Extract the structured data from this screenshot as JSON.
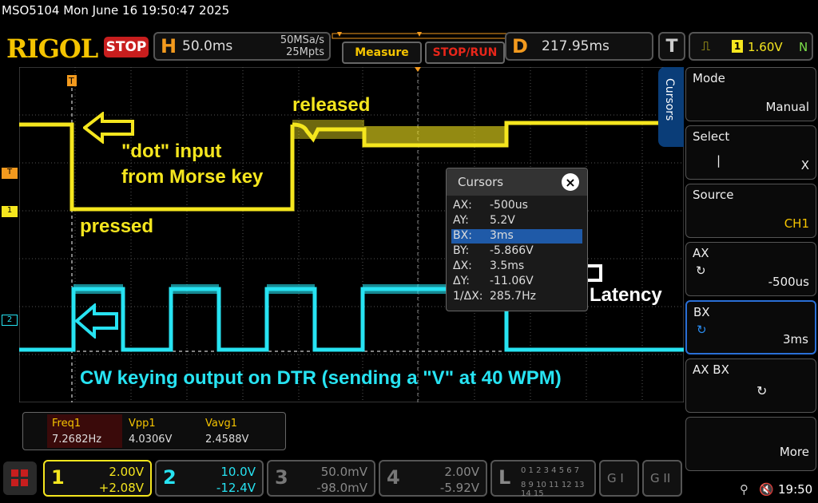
{
  "topline": "MSO5104  Mon June 16 19:50:47 2025",
  "brand": "RIGOL",
  "run_state": "STOP",
  "horizontal": {
    "letter": "H",
    "timebase": "50.0ms",
    "sample_rate": "50MSa/s",
    "depth": "25Mpts"
  },
  "buttons": {
    "measure": "Measure",
    "stop_run": "STOP/RUN"
  },
  "delay": {
    "letter": "D",
    "value": "217.95ms"
  },
  "trigger": {
    "letter": "T",
    "source": "1",
    "level": "1.60V",
    "mode": "N"
  },
  "side_tab": "Cursors",
  "menu": [
    {
      "title": "Mode",
      "value": "Manual"
    },
    {
      "title": "Select",
      "value": "X"
    },
    {
      "title": "Source",
      "value": "CH1"
    },
    {
      "title": "AX",
      "value": "-500us"
    },
    {
      "title": "BX",
      "value": "3ms"
    },
    {
      "title": "AX BX",
      "value": ""
    },
    {
      "title": "",
      "value": "More"
    }
  ],
  "cursors": {
    "title": "Cursors",
    "close": "×",
    "rows": [
      {
        "k": "AX:",
        "v": "-500us"
      },
      {
        "k": "AY:",
        "v": "5.2V"
      },
      {
        "k": "BX:",
        "v": "3ms"
      },
      {
        "k": "BY:",
        "v": "-5.866V"
      },
      {
        "k": "ΔX:",
        "v": "3.5ms"
      },
      {
        "k": "ΔY:",
        "v": "-11.06V"
      },
      {
        "k": "1/ΔX:",
        "v": "285.7Hz"
      }
    ]
  },
  "annotations": {
    "released": "released",
    "dot_line1": "\"dot\" input",
    "dot_line2": "from Morse key",
    "pressed": "pressed",
    "latency": "Latency",
    "cw": "CW keying output on DTR (sending a \"V\" at 40 WPM)"
  },
  "measurements": [
    {
      "label": "Freq1",
      "value": "7.2682Hz"
    },
    {
      "label": "Vpp1",
      "value": "4.0306V"
    },
    {
      "label": "Vavg1",
      "value": "2.4588V"
    }
  ],
  "channels": [
    {
      "num": "1",
      "scale": "2.00V",
      "offset": "+2.08V"
    },
    {
      "num": "2",
      "scale": "10.0V",
      "offset": "-12.4V"
    },
    {
      "num": "3",
      "scale": "50.0mV",
      "offset": "-98.0mV"
    },
    {
      "num": "4",
      "scale": "2.00V",
      "offset": "-5.92V"
    }
  ],
  "logic": {
    "letter": "L",
    "row1": "0 1 2 3  4 5 6 7",
    "row2": "8 9 10 11 12 13 14 15"
  },
  "gen": [
    "G I",
    "G II"
  ],
  "clock": "19:50",
  "colors": {
    "ch1": "#f5e61e",
    "ch2": "#27e3f2",
    "accent": "#f39a1e",
    "stop": "#c81e1e",
    "cursor_sel": "#1f5aa8"
  }
}
